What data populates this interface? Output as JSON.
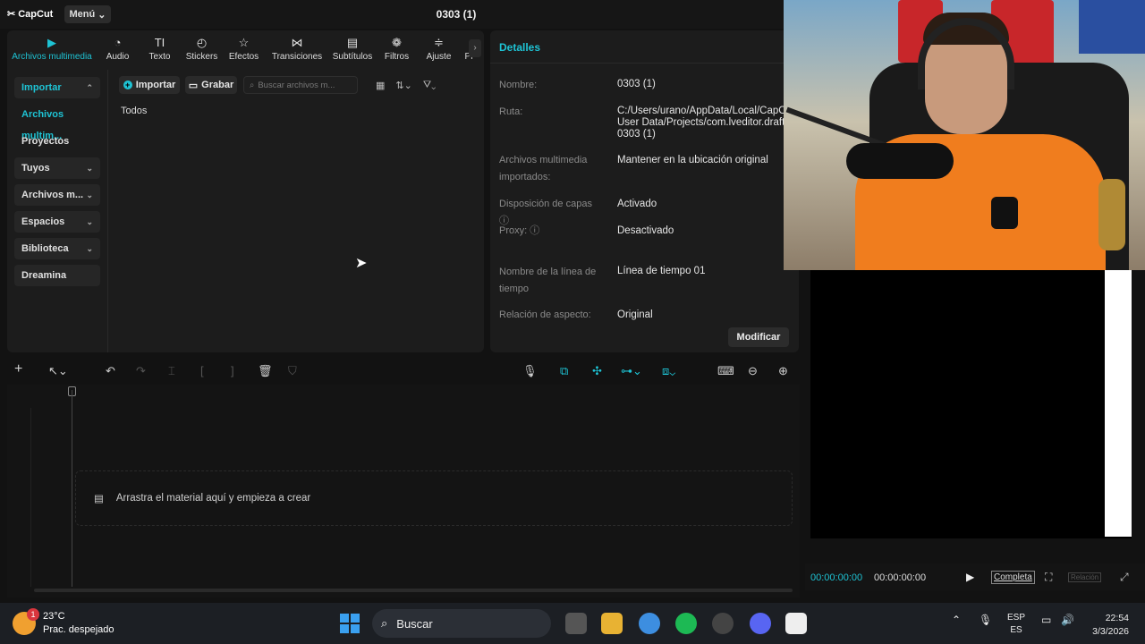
{
  "app": {
    "logo": "CapCut",
    "menu_label": "Menú",
    "project_title": "0303 (1)"
  },
  "media_tabs": [
    {
      "label": "Archivos multimedia",
      "icon": "media-icon"
    },
    {
      "label": "Audio",
      "icon": "audio-icon"
    },
    {
      "label": "Texto",
      "icon": "text-icon"
    },
    {
      "label": "Stickers",
      "icon": "sticker-icon"
    },
    {
      "label": "Efectos",
      "icon": "effects-icon"
    },
    {
      "label": "Transiciones",
      "icon": "transitions-icon"
    },
    {
      "label": "Subtítulos",
      "icon": "subtitles-icon"
    },
    {
      "label": "Filtros",
      "icon": "filters-icon"
    },
    {
      "label": "Ajuste",
      "icon": "adjust-icon"
    },
    {
      "label": "Pl",
      "icon": "plugins-icon"
    }
  ],
  "sidebar": [
    {
      "label": "Importar"
    },
    {
      "label": "Archivos multim..."
    },
    {
      "label": "Proyectos secun..."
    },
    {
      "label": "Tuyos"
    },
    {
      "label": "Archivos m..."
    },
    {
      "label": "Espacios"
    },
    {
      "label": "Biblioteca"
    },
    {
      "label": "Dreamina"
    }
  ],
  "media_toolbar": {
    "import_label": "Importar",
    "record_label": "Grabar",
    "search_placeholder": "Buscar archivos m..."
  },
  "media_filter": "Todos",
  "details": {
    "header": "Detalles",
    "rows": [
      {
        "label": "Nombre:",
        "value": "0303 (1)"
      },
      {
        "label": "Ruta:",
        "value": "C:/Users/urano/AppData/Local/CapC",
        "value2": "User Data/Projects/com.lveditor.draft/",
        "value3": "0303 (1)"
      },
      {
        "label": "Archivos multimedia",
        "label2": "importados:",
        "value": "Mantener en la ubicación original"
      },
      {
        "label": "Disposición de capas",
        "value": "Activado"
      },
      {
        "label": "Proxy:",
        "value": "Desactivado"
      },
      {
        "label": "Nombre de la línea de",
        "label2": "tiempo",
        "value": "Línea de tiempo 01"
      },
      {
        "label": "Relación de aspecto:",
        "value": "Original"
      }
    ],
    "modify_label": "Modificar"
  },
  "timeline": {
    "drop_hint": "Arrastra el material aquí y empieza a crear"
  },
  "player": {
    "current_time": "00:00:00:00",
    "total_time": "00:00:00:00",
    "full_label": "Completa",
    "ratio_label": "Relación"
  },
  "taskbar": {
    "temperature": "23°C",
    "weather": "Prac. despejado",
    "weather_badge": "1",
    "search_label": "Buscar",
    "lang_top": "ESP",
    "lang_bottom": "ES",
    "time": "22:54",
    "date": "3/3/2026"
  },
  "colors": {
    "accent": "#1ec3d4",
    "bg": "#121212",
    "panel": "#1c1c1c"
  }
}
